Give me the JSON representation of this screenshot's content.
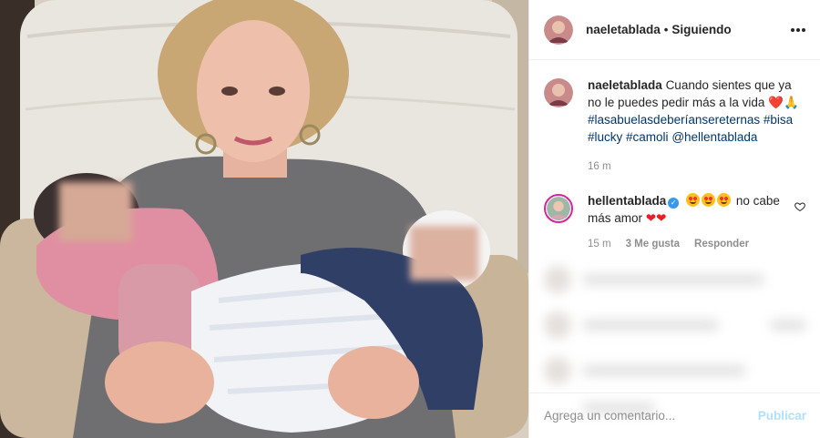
{
  "post": {
    "author": "naeletablada",
    "separator": "•",
    "follow_status": "Siguiendo",
    "menu_icon": "more-options-icon"
  },
  "caption": {
    "username": "naeletablada",
    "text": "Cuando sientes que ya no le puedes pedir más a la vida",
    "emojis": "❤️🙏",
    "hashtags": [
      "#lasabuelasdeberíansereternas",
      "#bisa",
      "#lucky",
      "#camoli"
    ],
    "mention": "@hellentablada",
    "time": "16 m"
  },
  "reply": {
    "username": "hellentablada",
    "verified": true,
    "text": "no cabe más amor",
    "hearts": "❤❤",
    "time": "15 m",
    "likes": "3 Me gusta",
    "reply_label": "Responder"
  },
  "add_comment": {
    "placeholder": "Agrega un comentario...",
    "publish_label": "Publicar"
  },
  "colors": {
    "link": "#00376b",
    "muted": "#8e8e8e",
    "publish_disabled": "#b2dffc",
    "verified": "#3897f0"
  }
}
